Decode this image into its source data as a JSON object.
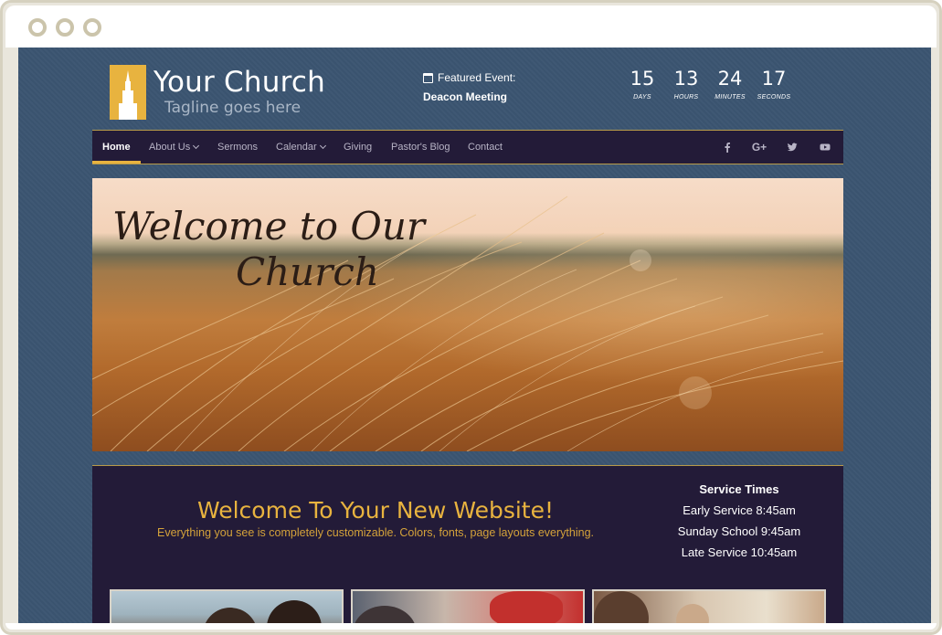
{
  "site": {
    "name": "Your Church",
    "tagline": "Tagline goes here"
  },
  "featured": {
    "label": "Featured Event:",
    "event": "Deacon Meeting",
    "icon": "calendar-icon"
  },
  "countdown": [
    {
      "value": "15",
      "unit": "DAYS"
    },
    {
      "value": "13",
      "unit": "HOURS"
    },
    {
      "value": "24",
      "unit": "MINUTES"
    },
    {
      "value": "17",
      "unit": "SECONDS"
    }
  ],
  "nav": {
    "items": [
      {
        "label": "Home",
        "active": true
      },
      {
        "label": "About Us",
        "dropdown": true
      },
      {
        "label": "Sermons"
      },
      {
        "label": "Calendar",
        "dropdown": true
      },
      {
        "label": "Giving"
      },
      {
        "label": "Pastor's Blog"
      },
      {
        "label": "Contact"
      }
    ],
    "social": [
      "facebook-icon",
      "google-plus-icon",
      "twitter-icon",
      "youtube-icon"
    ],
    "google_plus_label": "G+"
  },
  "hero": {
    "title_line1": "Welcome to Our",
    "title_line2": "Church"
  },
  "welcome": {
    "title": "Welcome To Your New Website!",
    "subtitle": "Everything you see is completely customizable. Colors, fonts, page layouts everything."
  },
  "service_times": {
    "title": "Service Times",
    "rows": [
      "Early Service 8:45am",
      "Sunday School 9:45am",
      "Late Service 10:45am"
    ]
  },
  "colors": {
    "accent": "#e8b33f",
    "nav_bg": "#231b38",
    "page_bg": "#3b5571"
  }
}
